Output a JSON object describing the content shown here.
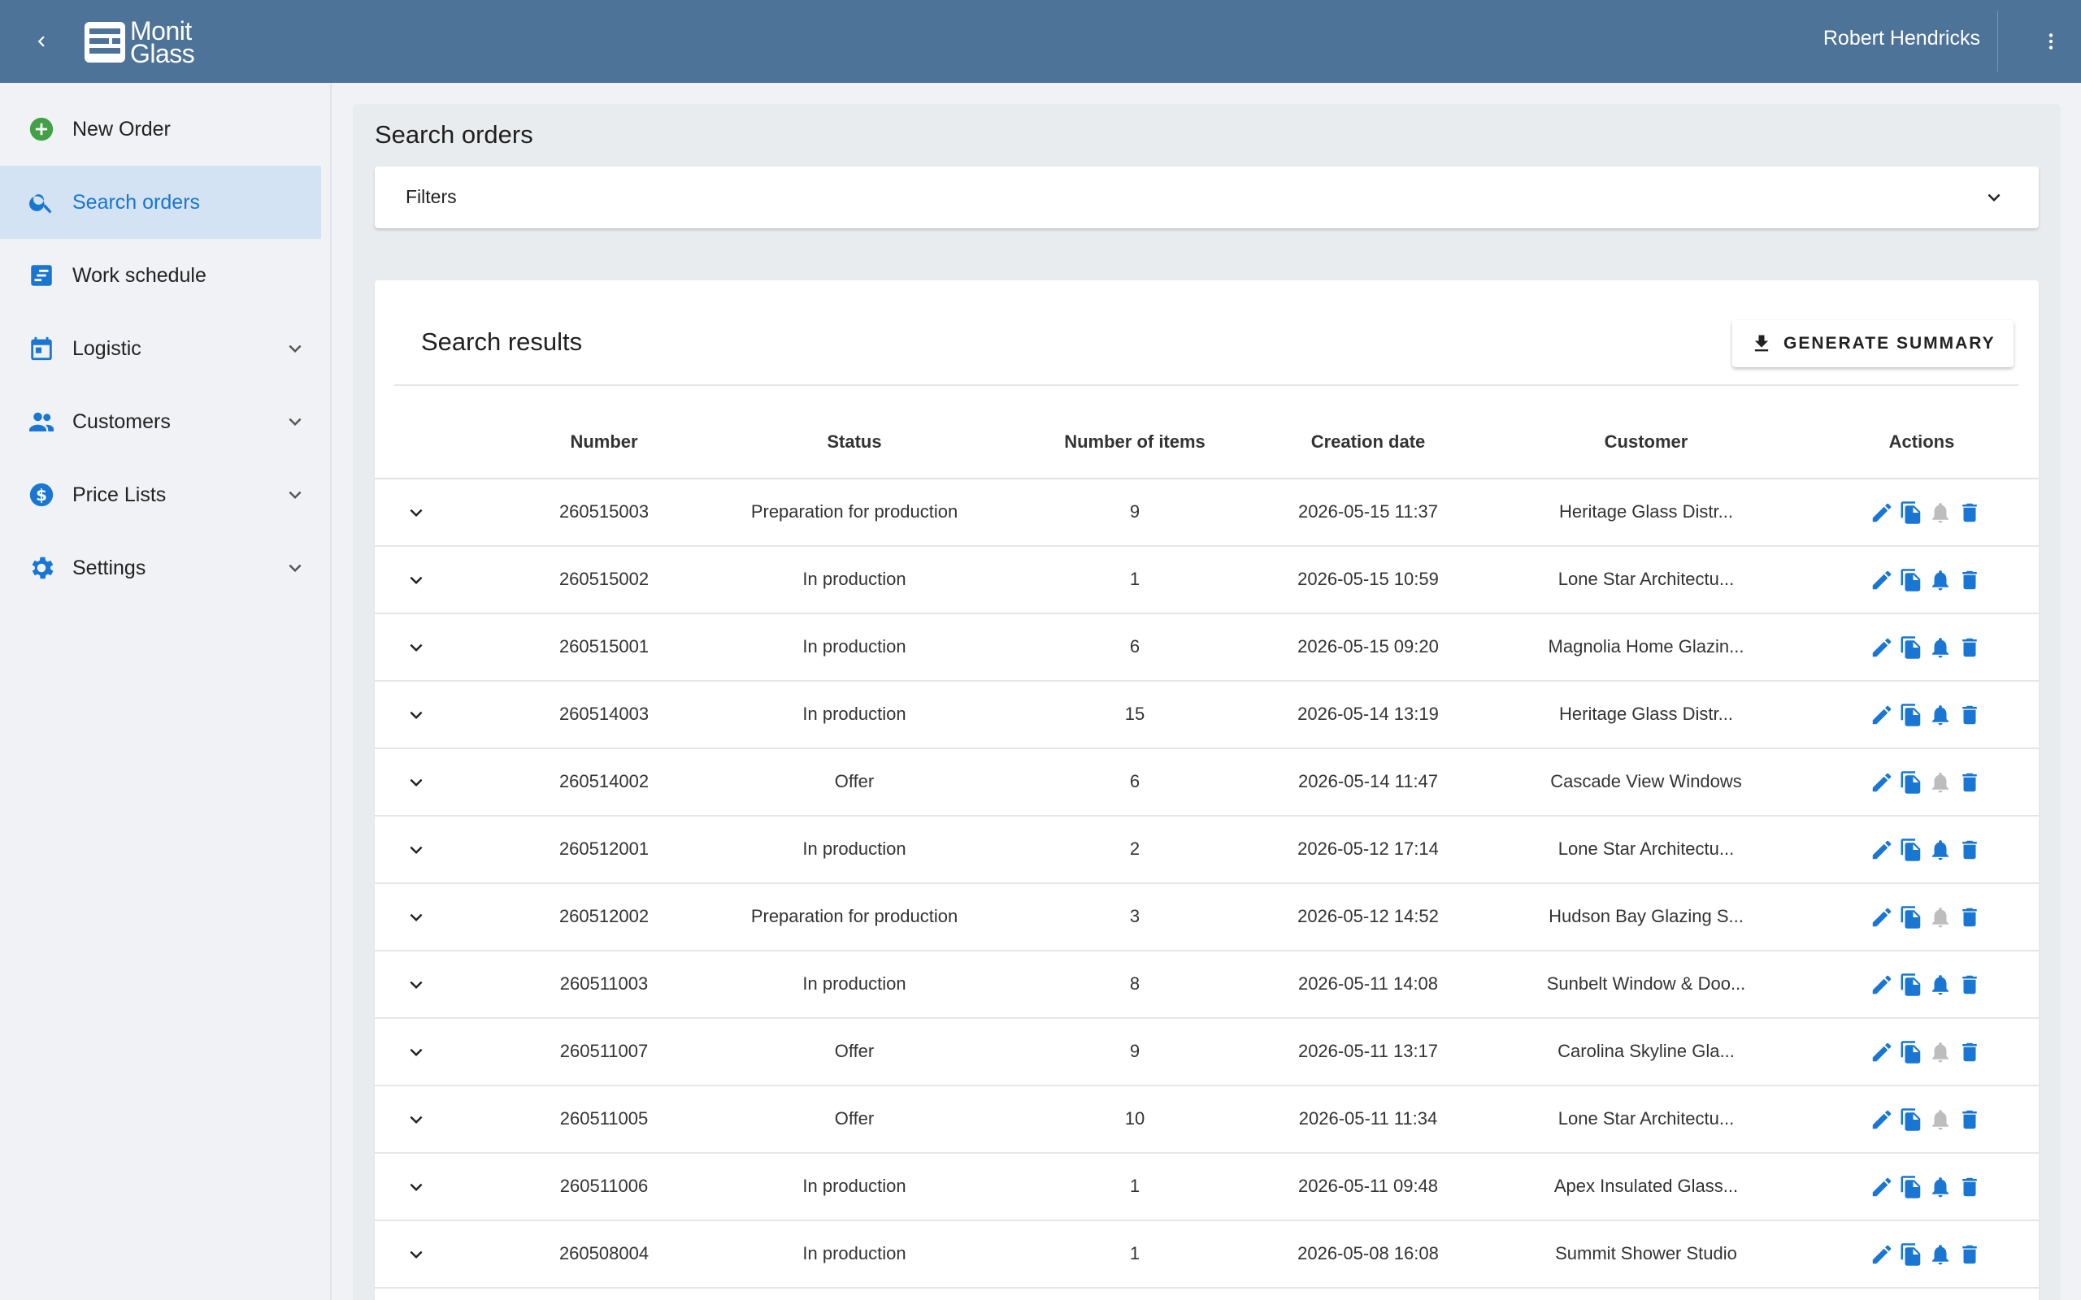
{
  "header": {
    "logo_line1": "Monit",
    "logo_line2": "Glass",
    "user_name": "Robert Hendricks"
  },
  "sidebar": {
    "items": [
      {
        "label": "New Order",
        "icon": "add-circle-icon",
        "icon_color": "#43a047"
      },
      {
        "label": "Search orders",
        "icon": "search-icon",
        "active": true
      },
      {
        "label": "Work schedule",
        "icon": "schedule-icon"
      },
      {
        "label": "Logistic",
        "icon": "calendar-icon",
        "expandable": true
      },
      {
        "label": "Customers",
        "icon": "people-icon",
        "expandable": true
      },
      {
        "label": "Price Lists",
        "icon": "dollar-icon",
        "expandable": true
      },
      {
        "label": "Settings",
        "icon": "gear-icon",
        "expandable": true
      }
    ]
  },
  "page": {
    "title": "Search orders",
    "filters_label": "Filters"
  },
  "results": {
    "title": "Search results",
    "generate_label": "GENERATE SUMMARY",
    "columns": [
      "Number",
      "Status",
      "Number of items",
      "Creation date",
      "Customer",
      "Actions"
    ],
    "rows": [
      {
        "number": "260515003",
        "status": "Preparation for production",
        "items": "9",
        "date": "2026-05-15 11:37",
        "customer": "Heritage Glass Distr...",
        "notify_active": false
      },
      {
        "number": "260515002",
        "status": "In production",
        "items": "1",
        "date": "2026-05-15 10:59",
        "customer": "Lone Star Architectu...",
        "notify_active": true
      },
      {
        "number": "260515001",
        "status": "In production",
        "items": "6",
        "date": "2026-05-15 09:20",
        "customer": "Magnolia Home Glazin...",
        "notify_active": true
      },
      {
        "number": "260514003",
        "status": "In production",
        "items": "15",
        "date": "2026-05-14 13:19",
        "customer": "Heritage Glass Distr...",
        "notify_active": true
      },
      {
        "number": "260514002",
        "status": "Offer",
        "items": "6",
        "date": "2026-05-14 11:47",
        "customer": "Cascade View Windows",
        "notify_active": false
      },
      {
        "number": "260512001",
        "status": "In production",
        "items": "2",
        "date": "2026-05-12 17:14",
        "customer": "Lone Star Architectu...",
        "notify_active": true
      },
      {
        "number": "260512002",
        "status": "Preparation for production",
        "items": "3",
        "date": "2026-05-12 14:52",
        "customer": "Hudson Bay Glazing S...",
        "notify_active": false
      },
      {
        "number": "260511003",
        "status": "In production",
        "items": "8",
        "date": "2026-05-11 14:08",
        "customer": "Sunbelt Window & Doo...",
        "notify_active": true
      },
      {
        "number": "260511007",
        "status": "Offer",
        "items": "9",
        "date": "2026-05-11 13:17",
        "customer": "Carolina Skyline Gla...",
        "notify_active": false
      },
      {
        "number": "260511005",
        "status": "Offer",
        "items": "10",
        "date": "2026-05-11 11:34",
        "customer": "Lone Star Architectu...",
        "notify_active": false
      },
      {
        "number": "260511006",
        "status": "In production",
        "items": "1",
        "date": "2026-05-11 09:48",
        "customer": "Apex Insulated Glass...",
        "notify_active": true
      },
      {
        "number": "260508004",
        "status": "In production",
        "items": "1",
        "date": "2026-05-08 16:08",
        "customer": "Summit Shower Studio",
        "notify_active": true
      }
    ]
  },
  "colors": {
    "header_bg": "#4e7399",
    "accent": "#1976d2",
    "active_nav_bg": "#d3e3f3",
    "inactive_bell": "#bdbdbd"
  }
}
